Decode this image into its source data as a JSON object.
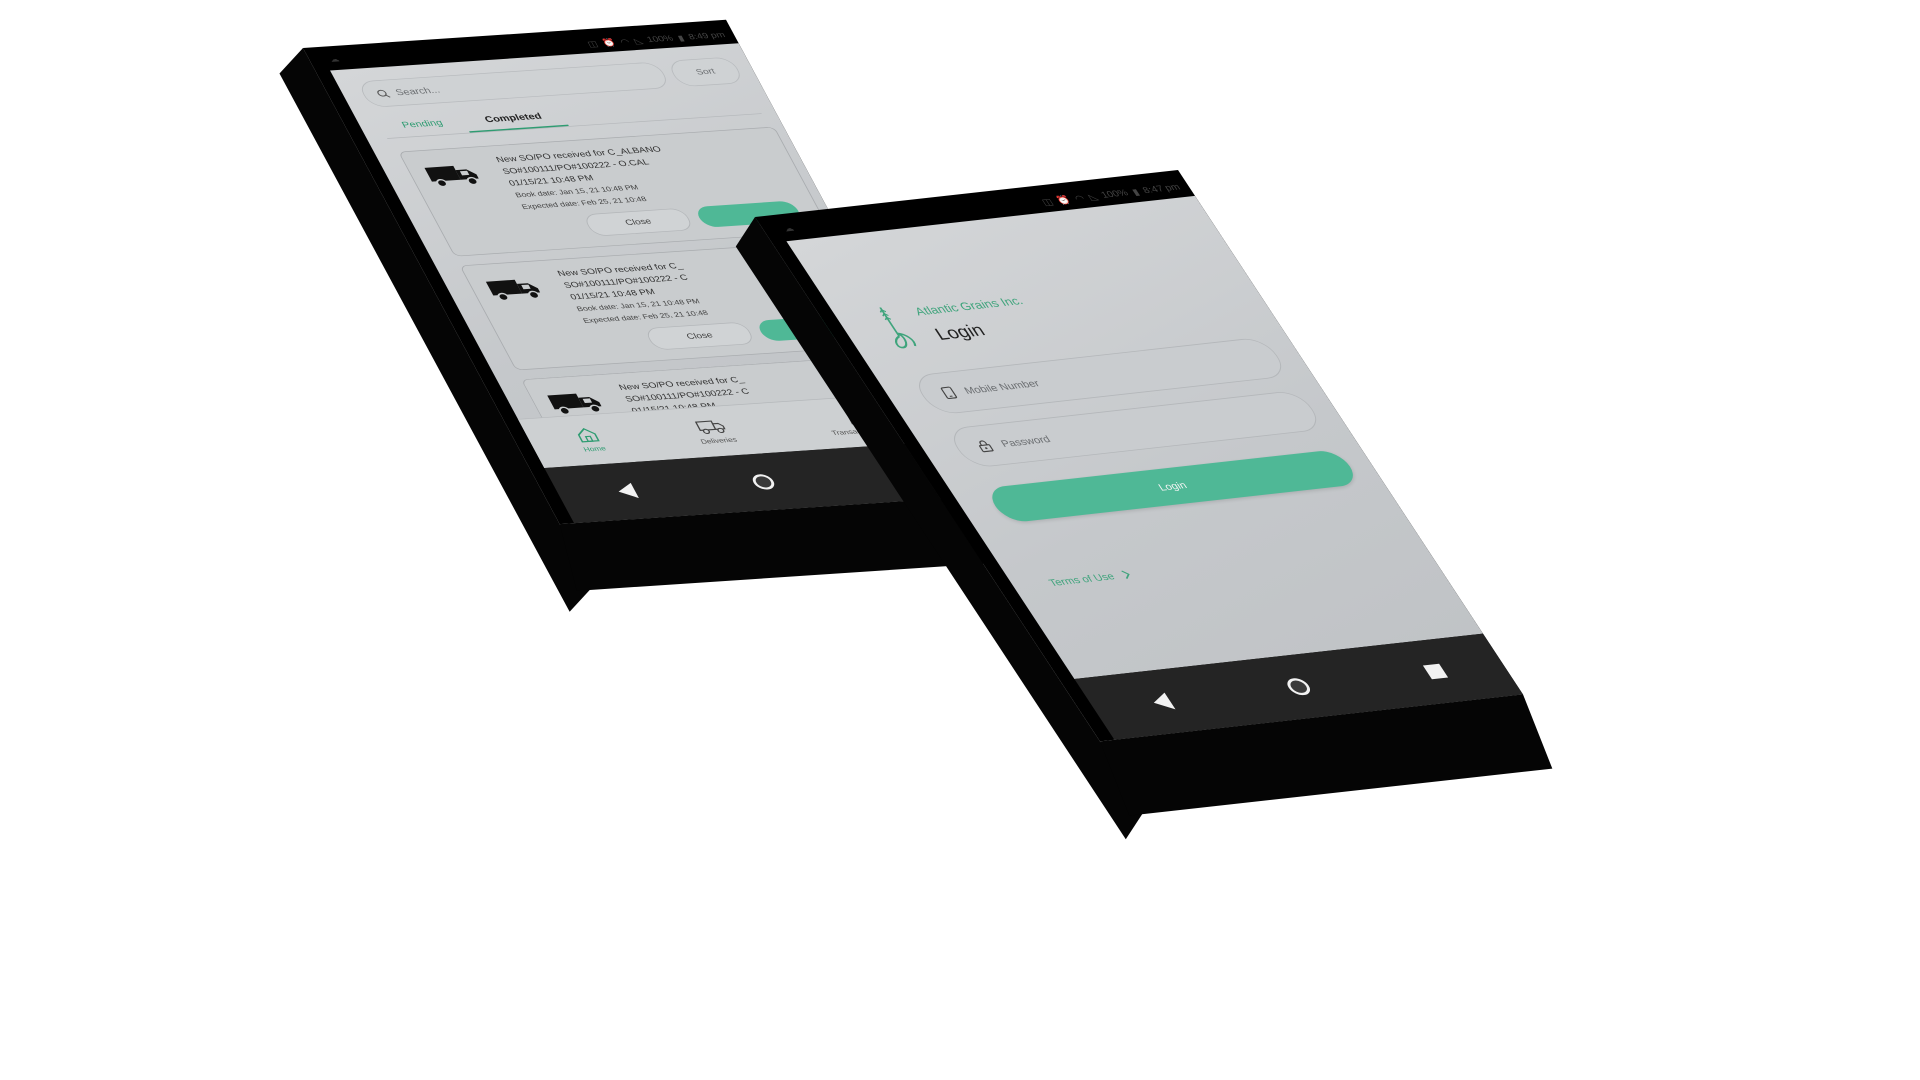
{
  "status_bar": {
    "home_time": "8:49 pm",
    "login_time": "8:47 pm",
    "battery": "100%"
  },
  "home": {
    "search": {
      "placeholder": "Search..."
    },
    "sort_label": "Sort",
    "tabs": [
      {
        "label": "Pending"
      },
      {
        "label": "Completed"
      }
    ],
    "cards": [
      {
        "title": "New SO/PO received for C_ALBANO",
        "order": "SO#100111/PO#100222 - O.CAL",
        "datetime": "01/15/21 10:48 PM",
        "book_date": "Book date: Jan 15, 21 10:48 PM",
        "expected_date": "Expected date: Feb 25, 21 10:48",
        "close_label": "Close"
      },
      {
        "title": "New SO/PO received for C_",
        "order": "SO#100111/PO#100222 - C",
        "datetime": "01/15/21 10:48 PM",
        "book_date": "Book date: Jan 15, 21 10:48 PM",
        "expected_date": "Expected date: Feb 25, 21 10:48",
        "close_label": "Close"
      },
      {
        "title": "New SO/PO received for C_",
        "order": "SO#100111/PO#100222 - C",
        "datetime": "01/15/21 10:48 PM"
      }
    ],
    "bottom_nav": [
      {
        "label": "Home",
        "icon": "home-icon"
      },
      {
        "label": "Deliveries",
        "icon": "truck-icon"
      },
      {
        "label": "Transaction Order",
        "icon": "list-icon"
      }
    ]
  },
  "login": {
    "brand_name": "Atlantic Grains Inc.",
    "title": "Login",
    "mobile_placeholder": "Mobile Number",
    "password_placeholder": "Password",
    "login_button": "Login",
    "terms_link": "Terms of Use"
  },
  "colors": {
    "accent": "#4fb896",
    "accent_text": "#3fa47c",
    "screen_bg": "#c8cbce",
    "device_body": "#050505",
    "nav_bar": "#242424"
  }
}
